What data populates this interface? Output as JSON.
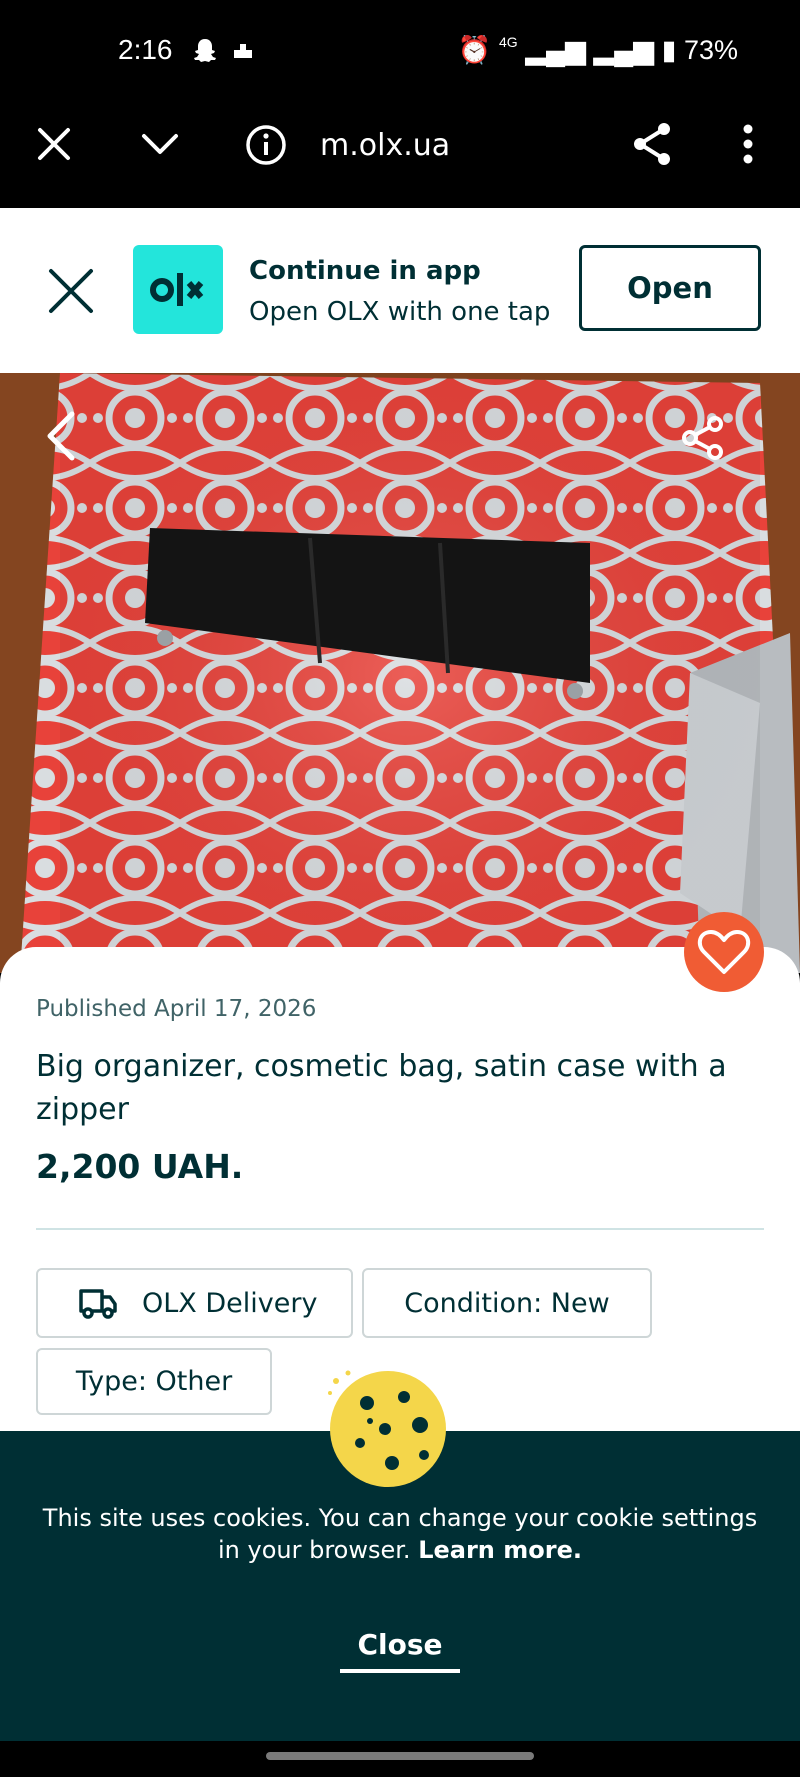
{
  "status_bar": {
    "time": "2:16",
    "battery": "73%",
    "network": "4G"
  },
  "browser": {
    "url": "m.olx.ua"
  },
  "app_banner": {
    "title": "Continue in app",
    "subtitle": "Open OLX with one tap",
    "open_label": "Open",
    "logo_text": "olx"
  },
  "listing": {
    "published": "Published April 17, 2026",
    "title": "Big organizer, cosmetic bag, satin case with a zipper",
    "price": "2,200 UAH.",
    "tags": [
      {
        "label": "OLX Delivery",
        "icon": "delivery-truck-icon"
      },
      {
        "label": "Condition: New"
      },
      {
        "label": "Type: Other"
      }
    ]
  },
  "cookie": {
    "text": "This site uses cookies. You can change your cookie settings in your browser.",
    "link": "Learn more.",
    "close_label": "Close"
  },
  "colors": {
    "brand_teal": "#23e5db",
    "dark": "#002f34",
    "favorite": "#f05c34"
  }
}
